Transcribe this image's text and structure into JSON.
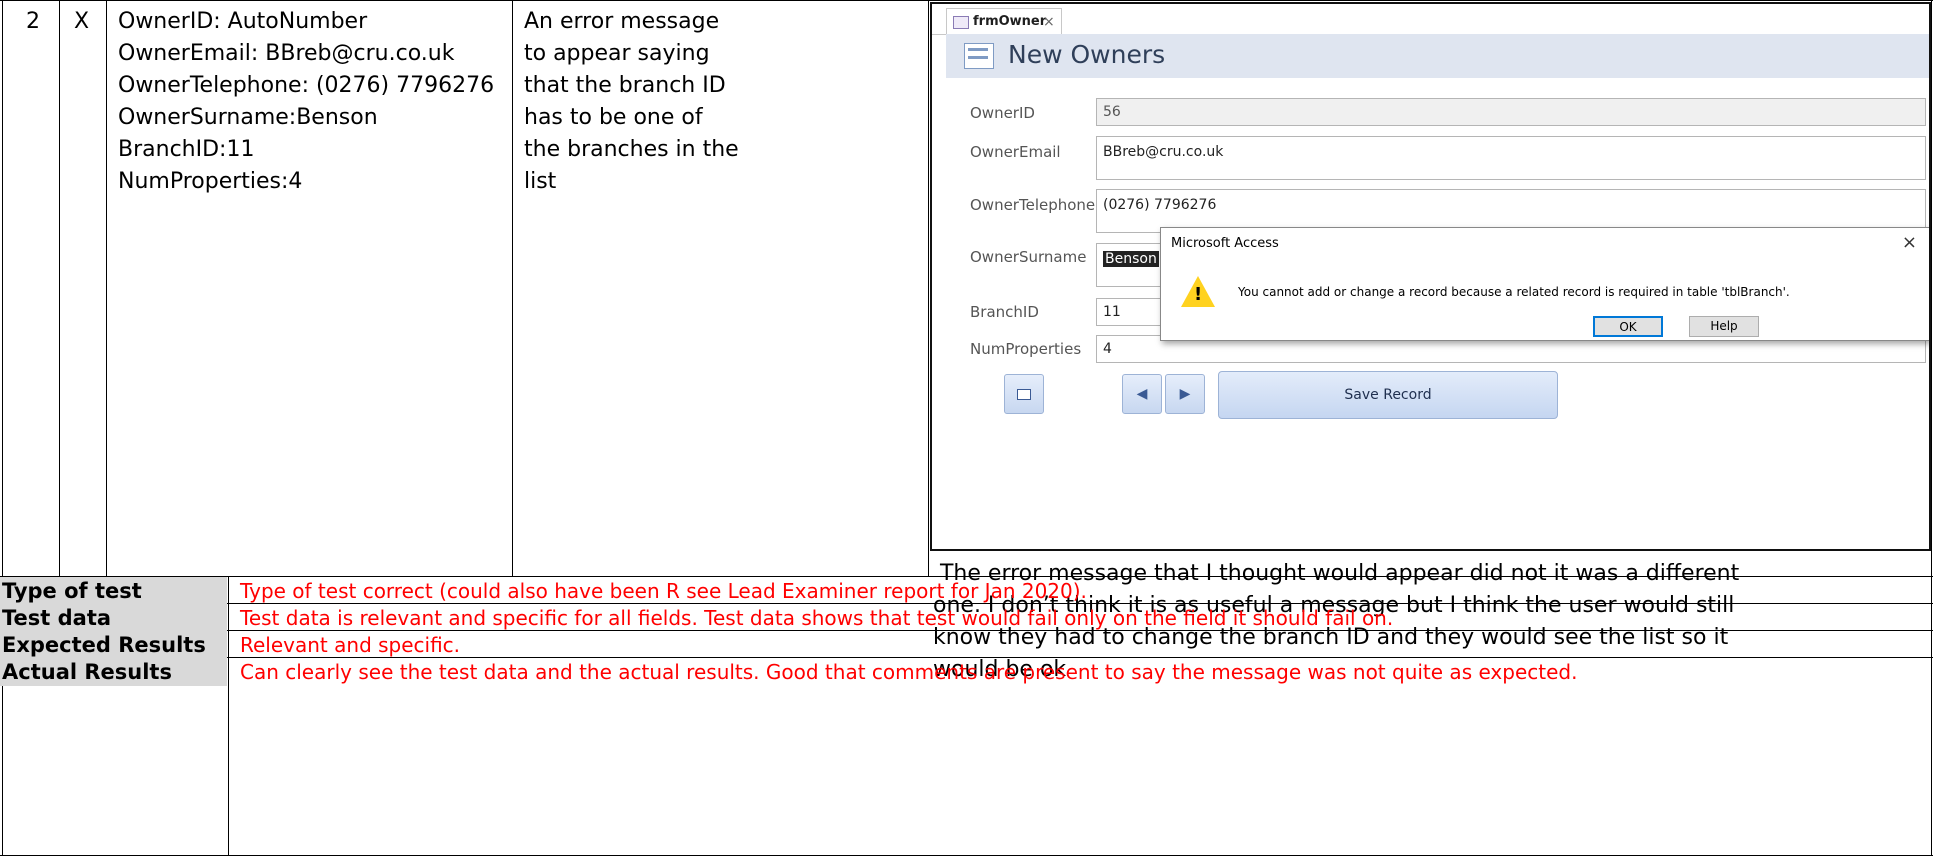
{
  "row": {
    "number": "2",
    "type": "X",
    "test_data_lines": [
      "OwnerID: AutoNumber",
      "OwnerEmail: BBreb@cru.co.uk",
      "OwnerTelephone: (0276) 7796276",
      "OwnerSurname:Benson",
      "BranchID:11",
      "NumProperties:4"
    ],
    "expected_lines": [
      "An error message",
      "to appear saying",
      "that the branch ID",
      "has to be one of",
      "the branches in the",
      "list"
    ],
    "comment_lines": [
      " The error message that I thought would appear did not it was a different",
      "one. I don’t think it is as useful a message but I think the user would still",
      "know they had to change the branch ID and they would see the list so it",
      "would be ok"
    ]
  },
  "screenshot": {
    "tab_label": "frmOwner",
    "tab_close": "×",
    "form_title": "New Owners",
    "fields": [
      {
        "label": "OwnerID",
        "value": "56"
      },
      {
        "label": "OwnerEmail",
        "value": "BBreb@cru.co.uk"
      },
      {
        "label": "OwnerTelephone",
        "value": "(0276) 7796276"
      },
      {
        "label": "OwnerSurname",
        "value": "Benson"
      },
      {
        "label": "BranchID",
        "value": "11"
      },
      {
        "label": "NumProperties",
        "value": "4"
      }
    ],
    "nav_first": "◀",
    "nav_last": "▶",
    "save_label": "Save Record",
    "dialog": {
      "title": "Microsoft Access",
      "close": "×",
      "warning_mark": "!",
      "message": "You cannot add or change a record because a related record is required in table 'tblBranch'.",
      "ok": "OK",
      "help": "Help"
    }
  },
  "feedback": [
    {
      "label": "Type of test",
      "text": "Type of test correct (could also have been R see Lead Examiner report for Jan 2020)."
    },
    {
      "label": "Test data",
      "text": "Test data is relevant and specific for all fields. Test data shows that test would fail only on the field it should fail on."
    },
    {
      "label": "Expected Results",
      "text": "Relevant and specific."
    },
    {
      "label": "Actual Results",
      "text": "Can clearly see the test data and the actual results.  Good that comments are present to say the message was not quite as expected."
    }
  ],
  "colors": {
    "feedback_text": "#ff0000",
    "label_bg": "#d9d9d9",
    "form_header": "#dfe5f0"
  }
}
